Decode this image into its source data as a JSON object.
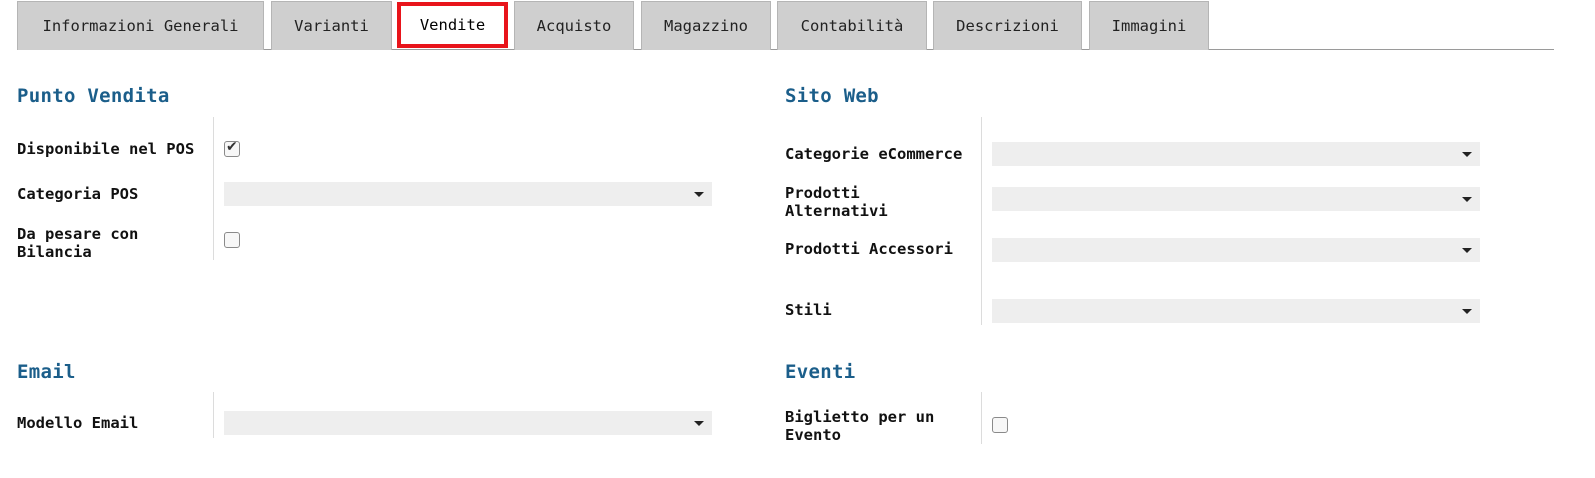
{
  "tabs": [
    {
      "label": "Informazioni Generali"
    },
    {
      "label": "Varianti"
    },
    {
      "label": "Vendite"
    },
    {
      "label": "Acquisto"
    },
    {
      "label": "Magazzino"
    },
    {
      "label": "Contabilità"
    },
    {
      "label": "Descrizioni"
    },
    {
      "label": "Immagini"
    }
  ],
  "active_tab": "Vendite",
  "colors": {
    "section_title": "#1b5e8a",
    "active_tab_border": "#e8141b",
    "tab_bg": "#cfcfcf",
    "field_bg": "#eeeeee"
  },
  "punto_vendita": {
    "title": "Punto Vendita",
    "disponibile_pos": {
      "label": "Disponibile nel POS",
      "checked": true
    },
    "categoria_pos": {
      "label": "Categoria POS",
      "value": ""
    },
    "da_pesare": {
      "label_line1": "Da pesare con",
      "label_line2": "Bilancia",
      "checked": false
    }
  },
  "sito_web": {
    "title": "Sito Web",
    "categorie_ecommerce": {
      "label": "Categorie eCommerce",
      "value": ""
    },
    "prodotti_alternativi": {
      "label_line1": "Prodotti",
      "label_line2": "Alternativi",
      "value": ""
    },
    "prodotti_accessori": {
      "label": "Prodotti Accessori",
      "value": ""
    },
    "stili": {
      "label": "Stili",
      "value": ""
    }
  },
  "email": {
    "title": "Email",
    "modello_email": {
      "label": "Modello Email",
      "value": ""
    }
  },
  "eventi": {
    "title": "Eventi",
    "biglietto": {
      "label_line1": "Biglietto per un",
      "label_line2": "Evento",
      "checked": false
    }
  }
}
